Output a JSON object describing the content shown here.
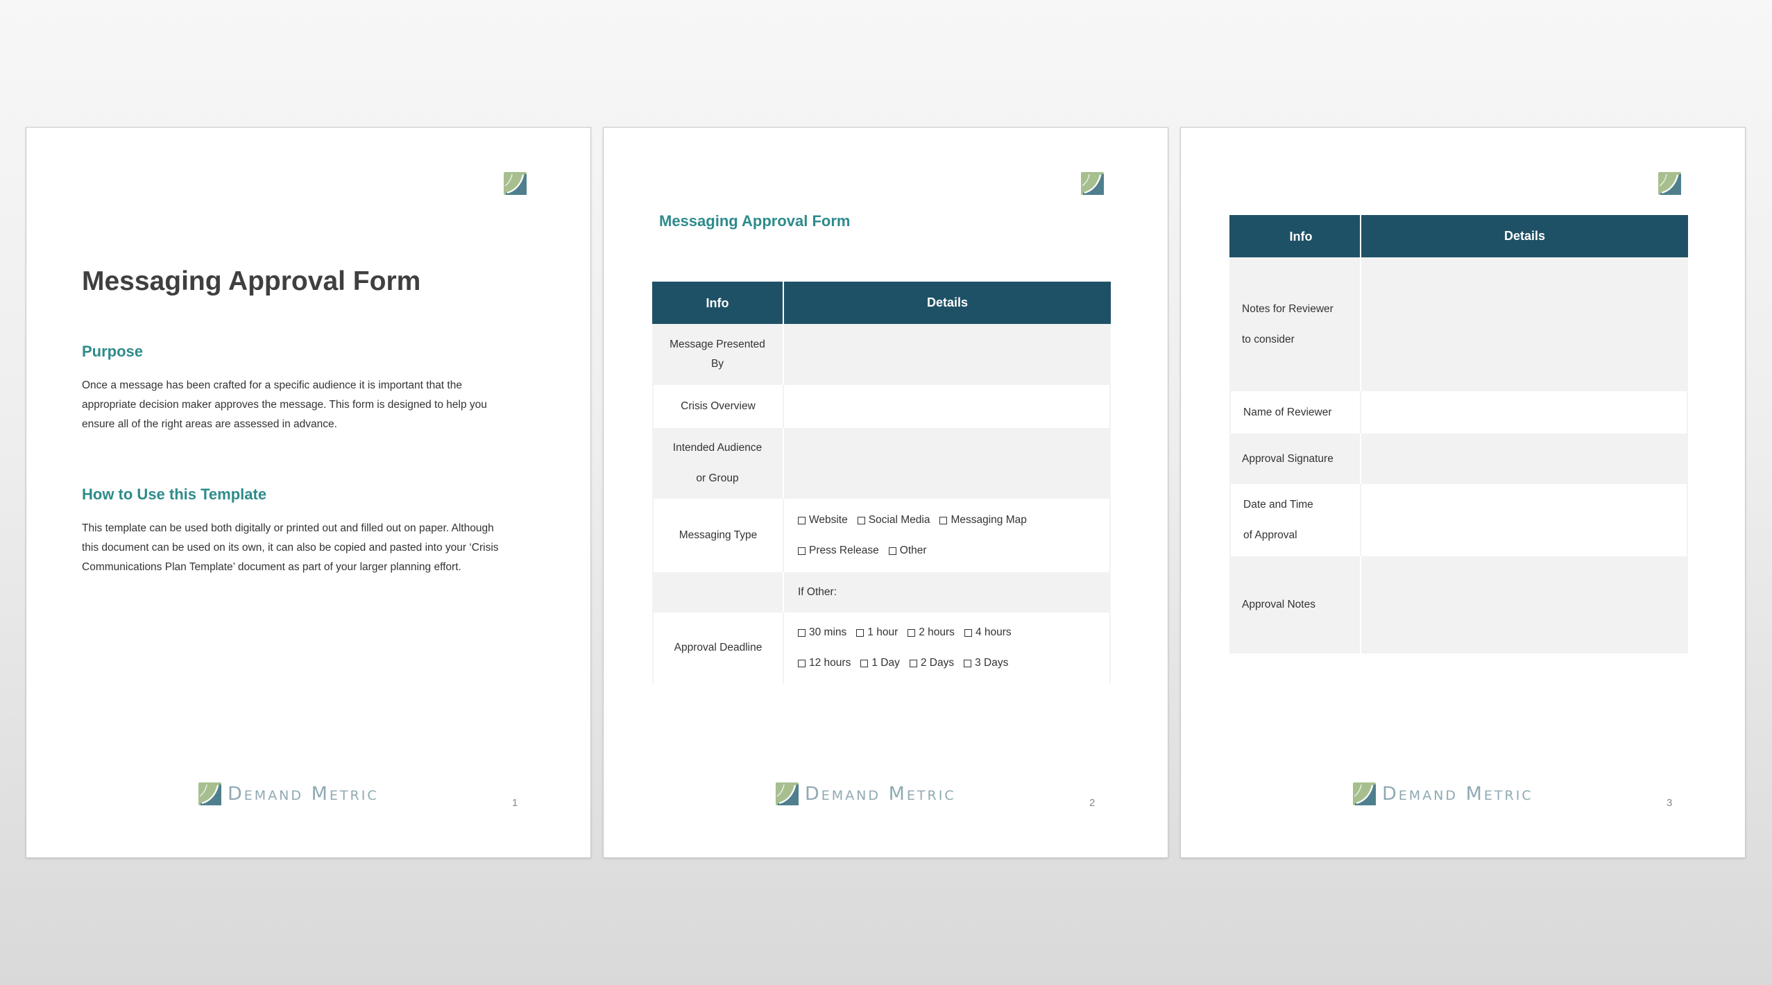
{
  "brand": {
    "name": "Demand Metric",
    "logo_icon": "demand-metric-logo-icon"
  },
  "page1": {
    "title": "Messaging Approval Form",
    "purpose_heading": "Purpose",
    "purpose_lines": [
      "Once a message has been crafted for a specific audience it is important that the",
      "appropriate decision maker approves the message. This form is designed to help you",
      "ensure all of the right areas are assessed in advance."
    ],
    "how_heading": "How to Use this Template",
    "how_lines": [
      "This template can be used both digitally or printed out and filled out on paper. Although",
      "this document can be used on its own, it can also be copied and pasted into your ‘Crisis",
      "Communications Plan Template’ document as part of your larger planning effort."
    ],
    "page_number": "1"
  },
  "page2": {
    "title": "Messaging Approval Form",
    "header_info": "Info",
    "header_details": "Details",
    "rows": {
      "presented_by": [
        "Message Presented",
        "By"
      ],
      "crisis_overview": "Crisis Overview",
      "intended_audience": [
        "Intended Audience",
        "or Group"
      ],
      "messaging_type": "Messaging Type",
      "messaging_options_line1": [
        "Website",
        "Social Media",
        "Messaging Map"
      ],
      "messaging_options_line2": [
        "Press Release",
        "Other"
      ],
      "if_other": "If Other:",
      "approval_deadline": "Approval Deadline",
      "deadline_options_line1": [
        "30 mins",
        "1 hour",
        "2 hours",
        "4 hours"
      ],
      "deadline_options_line2": [
        "12 hours",
        "1 Day",
        "2 Days",
        "3 Days"
      ]
    },
    "page_number": "2"
  },
  "page3": {
    "header_info": "Info",
    "header_details": "Details",
    "rows": {
      "notes_for_reviewer": [
        "Notes for Reviewer",
        "to consider"
      ],
      "name_of_reviewer": "Name of Reviewer",
      "approval_signature": "Approval Signature",
      "date_time": [
        "Date and Time",
        "of Approval"
      ],
      "approval_notes": "Approval Notes"
    },
    "page_number": "3"
  },
  "colors": {
    "header_bg": "#1f5166",
    "accent_teal": "#2e8b8b",
    "row_shade": "#f2f2f2",
    "brand_text": "#8fa9b3"
  }
}
